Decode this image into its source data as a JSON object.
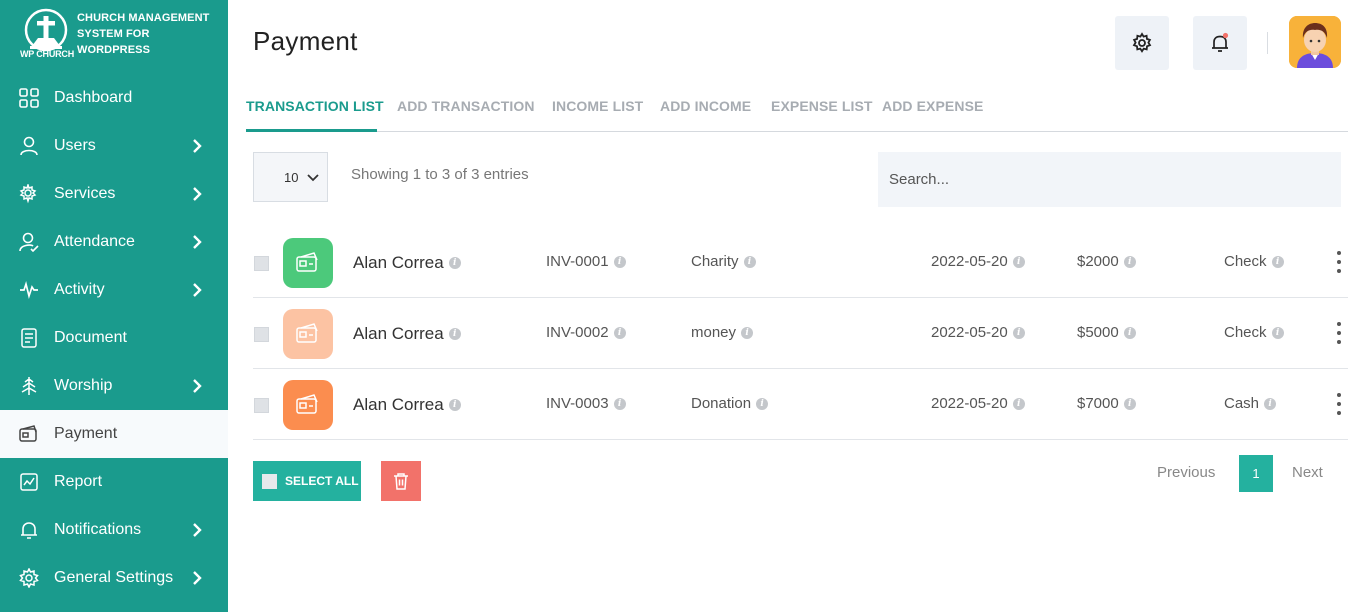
{
  "brand": {
    "name": "CHURCH MANAGEMENT SYSTEM FOR WORDPRESS",
    "logo_caption": "WP CHURCH"
  },
  "sidebar": {
    "items": [
      {
        "label": "Dashboard",
        "icon": "grid-icon",
        "has_arrow": false
      },
      {
        "label": "Users",
        "icon": "user-icon",
        "has_arrow": true
      },
      {
        "label": "Services",
        "icon": "services-icon",
        "has_arrow": true
      },
      {
        "label": "Attendance",
        "icon": "attendance-icon",
        "has_arrow": true
      },
      {
        "label": "Activity",
        "icon": "activity-icon",
        "has_arrow": true
      },
      {
        "label": "Document",
        "icon": "document-icon",
        "has_arrow": false
      },
      {
        "label": "Worship",
        "icon": "worship-icon",
        "has_arrow": true
      },
      {
        "label": "Payment",
        "icon": "payment-icon",
        "has_arrow": false,
        "active": true
      },
      {
        "label": "Report",
        "icon": "report-icon",
        "has_arrow": false
      },
      {
        "label": "Notifications",
        "icon": "bell-icon",
        "has_arrow": true
      },
      {
        "label": "General Settings",
        "icon": "gear-icon",
        "has_arrow": true
      }
    ]
  },
  "header": {
    "title": "Payment"
  },
  "tabs": [
    {
      "label": "TRANSACTION LIST",
      "active": true
    },
    {
      "label": "ADD TRANSACTION"
    },
    {
      "label": "INCOME LIST"
    },
    {
      "label": "ADD INCOME"
    },
    {
      "label": "EXPENSE LIST"
    },
    {
      "label": "ADD EXPENSE"
    }
  ],
  "table": {
    "per_page": "10",
    "entries_info": "Showing 1 to 3 of 3 entries",
    "search_placeholder": "Search...",
    "rows": [
      {
        "name": "Alan Correa",
        "invoice": "INV-0001",
        "type": "Charity",
        "date": "2022-05-20",
        "amount": "$2000",
        "method": "Check",
        "icon_color": "#4cc97b"
      },
      {
        "name": "Alan Correa",
        "invoice": "INV-0002",
        "type": "money",
        "date": "2022-05-20",
        "amount": "$5000",
        "method": "Check",
        "icon_color": "#fcc3a3"
      },
      {
        "name": "Alan Correa",
        "invoice": "INV-0003",
        "type": "Donation",
        "date": "2022-05-20",
        "amount": "$7000",
        "method": "Cash",
        "icon_color": "#fb8d4f"
      }
    ]
  },
  "actions": {
    "select_all": "SELECT ALL"
  },
  "pagination": {
    "previous": "Previous",
    "current": "1",
    "next": "Next"
  },
  "colors": {
    "accent": "#1a9b8d",
    "button": "#24b19f",
    "delete": "#f2726a"
  }
}
